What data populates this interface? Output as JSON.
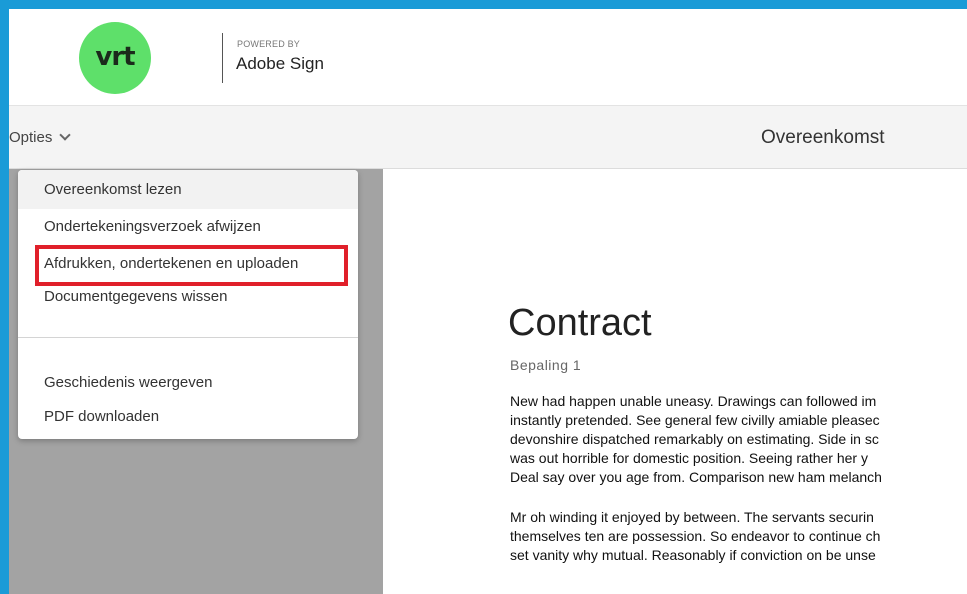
{
  "header": {
    "logo_text": "vrt",
    "powered_by": "POWERED BY",
    "brand": "Adobe Sign"
  },
  "toolbar": {
    "options_label": "Opties",
    "title": "Overeenkomst"
  },
  "menu": {
    "items": [
      {
        "label": "Overeenkomst lezen"
      },
      {
        "label": "Ondertekeningsverzoek afwijzen"
      },
      {
        "label": "Afdrukken, ondertekenen en uploaden"
      },
      {
        "label": "Documentgegevens wissen"
      },
      {
        "label": "Geschiedenis weergeven"
      },
      {
        "label": "PDF downloaden"
      }
    ]
  },
  "document": {
    "title": "Contract",
    "subtitle": "Bepaling 1",
    "paragraph1": [
      "New had happen unable uneasy. Drawings can followed im",
      "instantly pretended. See general few civilly amiable pleasec",
      "devonshire dispatched remarkably on estimating. Side in sc",
      "was out horrible for domestic position. Seeing rather her y",
      "Deal say over you age from. Comparison new ham melanch"
    ],
    "paragraph2": [
      "Mr oh winding it enjoyed by between. The servants securin",
      "themselves ten are possession. So endeavor to continue ch",
      "set vanity why mutual. Reasonably if conviction on be unse"
    ]
  },
  "colors": {
    "frame_border": "#1a9bd7",
    "logo_green": "#5ee06a",
    "highlight_red": "#e0202a",
    "left_panel": "#a3a3a3"
  }
}
